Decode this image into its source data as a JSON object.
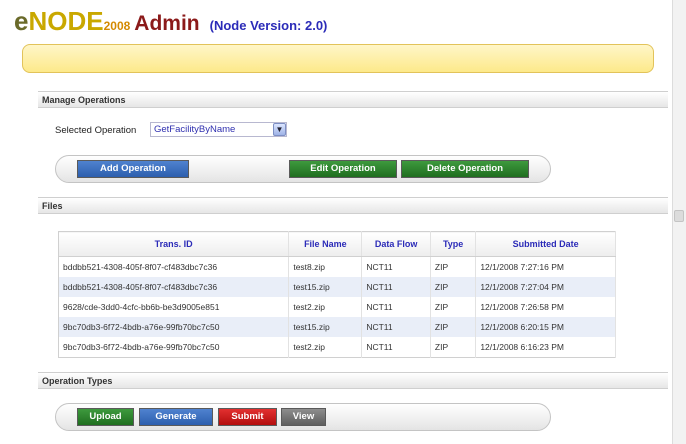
{
  "header": {
    "logo_e": "e",
    "logo_node": "NODE",
    "logo_year": "2008",
    "logo_admin": "Admin",
    "node_version": "(Node Version: 2.0)"
  },
  "manage_operations": {
    "title": "Manage Operations",
    "selected_label": "Selected Operation",
    "selected_value": "GetFacilityByName",
    "buttons": {
      "add": "Add Operation",
      "edit": "Edit Operation",
      "delete": "Delete Operation"
    }
  },
  "files": {
    "title": "Files",
    "columns": [
      "Trans. ID",
      "File Name",
      "Data Flow",
      "Type",
      "Submitted Date"
    ],
    "rows": [
      [
        "bddbb521-4308-405f-8f07-cf483dbc7c36",
        "test8.zip",
        "NCT11",
        "ZIP",
        "12/1/2008 7:27:16 PM"
      ],
      [
        "bddbb521-4308-405f-8f07-cf483dbc7c36",
        "test15.zip",
        "NCT11",
        "ZIP",
        "12/1/2008 7:27:04 PM"
      ],
      [
        "9628/cde-3dd0-4cfc-bb6b-be3d9005e851",
        "test2.zip",
        "NCT11",
        "ZIP",
        "12/1/2008 7:26:58 PM"
      ],
      [
        "9bc70db3-6f72-4bdb-a76e-99fb70bc7c50",
        "test15.zip",
        "NCT11",
        "ZIP",
        "12/1/2008 6:20:15 PM"
      ],
      [
        "9bc70db3-6f72-4bdb-a76e-99fb70bc7c50",
        "test2.zip",
        "NCT11",
        "ZIP",
        "12/1/2008 6:16:23 PM"
      ]
    ]
  },
  "operation_types": {
    "title": "Operation Types",
    "buttons": {
      "upload": "Upload",
      "generate": "Generate",
      "submit": "Submit",
      "view": "View"
    }
  },
  "icons": {
    "dropdown": "chevron-down-icon"
  },
  "colors": {
    "title_blue": "#2b2bb8",
    "admin_red": "#8b1a1a",
    "banner_yellow": "#fde98a",
    "button_blue": "#2d5fae",
    "button_green": "#1f6e1f",
    "button_red": "#b30d0d",
    "button_gray": "#5e5e5e"
  }
}
